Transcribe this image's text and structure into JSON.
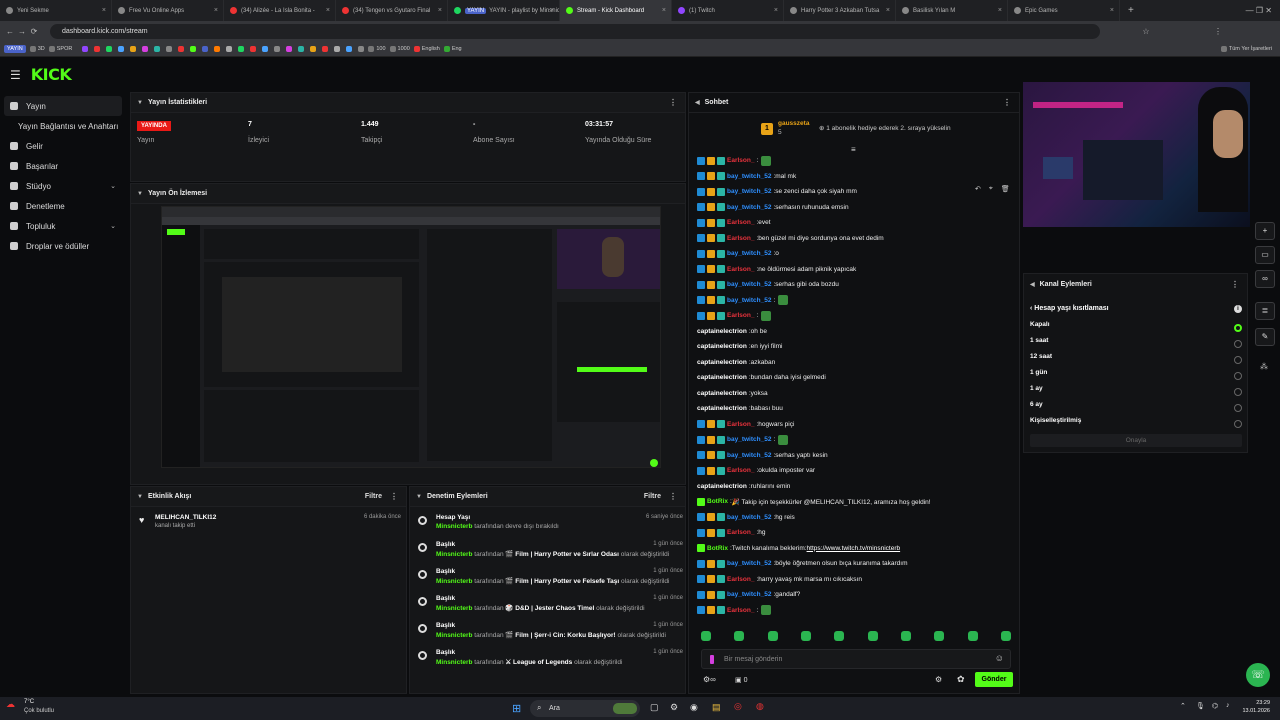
{
  "browser": {
    "tabs": [
      {
        "title": "Yeni Sekme",
        "kind": "plain"
      },
      {
        "title": "Free Vu Online Apps",
        "kind": "plain"
      },
      {
        "title": "(34) Alizée - La Isla Bonita -",
        "kind": "yt"
      },
      {
        "title": "(34) Tengen vs Gyutaro Final",
        "kind": "yt"
      },
      {
        "title": "YAYIN - playlist by Minsnicter",
        "kind": "sp",
        "badge": "YAYIN"
      },
      {
        "title": "Stream - Kick Dashboard",
        "kind": "kick",
        "active": true
      },
      {
        "title": "(1) Twitch",
        "kind": "tw"
      },
      {
        "title": "Harry Potter 3 Azkaban Tutsa",
        "kind": "plain"
      },
      {
        "title": "Basilisk Yılan M",
        "kind": "plain"
      },
      {
        "title": "Epic Games",
        "kind": "plain"
      }
    ],
    "url": "dashboard.kick.com/stream",
    "bookmarks": [
      "YAYIN",
      "3D",
      "SPOR",
      "English",
      "Eng"
    ],
    "all_bookmarks": "Tüm Yer İşaretleri",
    "bookmark_nums": [
      "100",
      "1000"
    ]
  },
  "sidebar": {
    "items": [
      {
        "label": "Yayın",
        "active": true,
        "icon": "broadcast-icon"
      },
      {
        "label": "Yayın Bağlantısı ve Anahtarı",
        "sub": true
      },
      {
        "label": "Gelir",
        "icon": "dollar-icon"
      },
      {
        "label": "Başarılar",
        "icon": "trophy-icon"
      },
      {
        "label": "Stüdyo",
        "icon": "studio-icon",
        "chev": true
      },
      {
        "label": "Denetleme",
        "icon": "hammer-icon"
      },
      {
        "label": "Topluluk",
        "icon": "community-icon",
        "chev": true
      },
      {
        "label": "Droplar ve ödüller",
        "icon": "gift-icon"
      }
    ]
  },
  "stats": {
    "title": "Yayın İstatistikleri",
    "live_badge": "YAYINDA",
    "cells": [
      {
        "label": "Yayın",
        "value": ""
      },
      {
        "label": "İzleyici",
        "value": "7"
      },
      {
        "label": "Takipçi",
        "value": "1.449"
      },
      {
        "label": "Abone Sayısı",
        "value": "-"
      },
      {
        "label": "Yayında Olduğu Süre",
        "value": "03:31:57"
      }
    ]
  },
  "preview": {
    "title": "Yayın Ön İzlemesi"
  },
  "events": {
    "title": "Etkinlik Akışı",
    "filter": "Filtre",
    "items": [
      {
        "user": "MELIHCAN_TILKI12",
        "action": "kanalı takip etti",
        "ago": "6 dakika önce"
      }
    ]
  },
  "moderation": {
    "title": "Denetim Eylemleri",
    "filter": "Filtre",
    "items": [
      {
        "title": "Hesap Yaşı",
        "who": "Minsnicterb",
        "mid": "tarafından devre dışı bırakıldı",
        "target": "",
        "tail": "",
        "ago": "6 saniye önce"
      },
      {
        "title": "Başlık",
        "who": "Minsnicterb",
        "mid": "tarafından",
        "target": "🎬 Film | Harry Potter ve Sırlar Odası",
        "tail": "olarak değiştirildi",
        "ago": "1 gün önce"
      },
      {
        "title": "Başlık",
        "who": "Minsnicterb",
        "mid": "tarafından",
        "target": "🎬 Film | Harry Potter ve Felsefe Taşı",
        "tail": "olarak değiştirildi",
        "ago": "1 gün önce"
      },
      {
        "title": "Başlık",
        "who": "Minsnicterb",
        "mid": "tarafından",
        "target": "🎲 D&D | Jester Chaos Timel",
        "tail": "olarak değiştirildi",
        "ago": "1 gün önce"
      },
      {
        "title": "Başlık",
        "who": "Minsnicterb",
        "mid": "tarafından",
        "target": "🎬 Film | Şerr-i Cin: Korku Başlıyor!",
        "tail": "olarak değiştirildi",
        "ago": "1 gün önce"
      },
      {
        "title": "Başlık",
        "who": "Minsnicterb",
        "mid": "tarafından",
        "target": "⚔ League of Legends",
        "tail": "olarak değiştirildi",
        "ago": "1 gün önce"
      }
    ]
  },
  "chat": {
    "title": "Sohbet",
    "pinned_user": "gausszeta",
    "pinned_count": "5",
    "pinned_note": "1 abonelik hediye ederek 2. sıraya yükselin",
    "messages": [
      {
        "user": "Earlson_",
        "color": "red",
        "text": "",
        "emote": true,
        "badges": 3
      },
      {
        "user": "bay_twitch_52",
        "color": "blue",
        "text": "mal mk",
        "badges": 3
      },
      {
        "user": "bay_twitch_52",
        "color": "blue",
        "text": "se zenci daha çok siyah mm",
        "badges": 3
      },
      {
        "user": "bay_twitch_52",
        "color": "blue",
        "text": "serhasın ruhunuda emsin",
        "badges": 3
      },
      {
        "user": "Earlson_",
        "color": "red",
        "text": "evet",
        "badges": 3
      },
      {
        "user": "Earlson_",
        "color": "red",
        "text": "ben güzel mi diye sordunya ona evet dedim",
        "badges": 3
      },
      {
        "user": "bay_twitch_52",
        "color": "blue",
        "text": "o",
        "badges": 3
      },
      {
        "user": "Earlson_",
        "color": "red",
        "text": "ne öldürmesi adam piknik yapıcak",
        "badges": 3
      },
      {
        "user": "bay_twitch_52",
        "color": "blue",
        "text": "serhas gibi oda bozdu",
        "badges": 3
      },
      {
        "user": "bay_twitch_52",
        "color": "blue",
        "text": "",
        "emote": true,
        "badges": 3
      },
      {
        "user": "Earlson_",
        "color": "red",
        "text": "",
        "emote": true,
        "badges": 3
      },
      {
        "user": "captainelectrion",
        "color": "white",
        "text": "oh be",
        "badges": 0
      },
      {
        "user": "captainelectrion",
        "color": "white",
        "text": "en iyyi filmi",
        "badges": 0
      },
      {
        "user": "captainelectrion",
        "color": "white",
        "text": "azkaban",
        "badges": 0
      },
      {
        "user": "captainelectrion",
        "color": "white",
        "text": "bundan daha iyisi gelmedi",
        "badges": 0
      },
      {
        "user": "captainelectrion",
        "color": "white",
        "text": "yoksa",
        "badges": 0
      },
      {
        "user": "captainelectrion",
        "color": "white",
        "text": "babası buu",
        "badges": 0
      },
      {
        "user": "Earlson_",
        "color": "red",
        "text": "hogwars piçi",
        "badges": 3
      },
      {
        "user": "bay_twitch_52",
        "color": "blue",
        "text": "",
        "emote": true,
        "badges": 3
      },
      {
        "user": "bay_twitch_52",
        "color": "blue",
        "text": "serhas yaptı kesin",
        "badges": 3
      },
      {
        "user": "Earlson_",
        "color": "red",
        "text": "okulda imposter var",
        "badges": 3
      },
      {
        "user": "captainelectrion",
        "color": "white",
        "text": "ruhlarını emin",
        "badges": 0
      },
      {
        "user": "BotRix",
        "color": "green",
        "text": "🎉 Takip için teşekkürler @MELIHCAN_TILKI12, aramıza hoş geldin!",
        "badges": 1
      },
      {
        "user": "bay_twitch_52",
        "color": "blue",
        "text": "hg reis",
        "badges": 3
      },
      {
        "user": "Earlson_",
        "color": "red",
        "text": "hg",
        "badges": 3
      },
      {
        "user": "BotRix",
        "color": "green",
        "text": "Twitch kanalıma beklerim: ",
        "link": "https://www.twitch.tv/minsnicterb",
        "badges": 1
      },
      {
        "user": "bay_twitch_52",
        "color": "blue",
        "text": "böyle öğretmen olsun bıça kuranıma takardım",
        "badges": 3
      },
      {
        "user": "Earlson_",
        "color": "red",
        "text": "harry yavaş mk marsa mı cıkıcaksın",
        "badges": 3
      },
      {
        "user": "bay_twitch_52",
        "color": "blue",
        "text": "gandalf?",
        "badges": 3
      },
      {
        "user": "Earlson_",
        "color": "red",
        "text": "",
        "emote": true,
        "badges": 3
      }
    ],
    "input_placeholder": "Bir mesaj gönderin",
    "points": "0",
    "send": "Gönder"
  },
  "channel_actions": {
    "title": "Kanal Eylemleri",
    "sub_title": "Hesap yaşı kısıtlaması",
    "options": [
      {
        "label": "Kapalı",
        "selected": true
      },
      {
        "label": "1 saat"
      },
      {
        "label": "12 saat"
      },
      {
        "label": "1 gün"
      },
      {
        "label": "1 ay"
      },
      {
        "label": "6 ay"
      },
      {
        "label": "Kişiselleştirilmiş"
      }
    ],
    "confirm": "Onayla"
  },
  "taskbar": {
    "weather_temp": "7°C",
    "weather_desc": "Çok bulutlu",
    "search": "Ara",
    "time": "23:29",
    "date": "13.01.2026"
  },
  "colors": {
    "accent": "#53fc18",
    "live": "#e91916",
    "bg": "#0b0c0e",
    "panel": "#151618"
  }
}
